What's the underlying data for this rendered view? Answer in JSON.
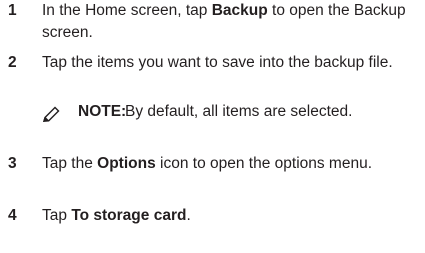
{
  "steps": [
    {
      "number": "1",
      "text_before": "In the Home screen, tap ",
      "emphasis": "Backup",
      "text_after": " to open the Backup screen."
    },
    {
      "number": "2",
      "text": "Tap the items you want to save into the backup file."
    },
    {
      "number": "3",
      "text_before": "Tap the ",
      "emphasis": "Options",
      "text_after": " icon to open the options menu."
    },
    {
      "number": "4",
      "text_before": "Tap ",
      "emphasis": "To storage card",
      "text_after": "."
    }
  ],
  "note": {
    "icon": "note-pencil-icon",
    "label": "NOTE:",
    "text": " By default, all items are selected."
  }
}
